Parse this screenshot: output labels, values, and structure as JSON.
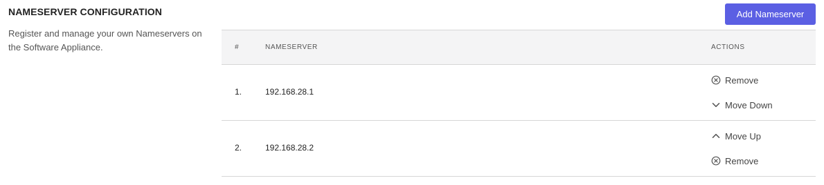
{
  "section": {
    "title": "NAMESERVER CONFIGURATION",
    "description": "Register and manage your own Nameservers on the Software Appliance."
  },
  "toolbar": {
    "add_label": "Add Nameserver"
  },
  "table": {
    "headers": {
      "num": "#",
      "nameserver": "NAMESERVER",
      "actions": "ACTIONS"
    },
    "rows": [
      {
        "num": "1.",
        "nameserver": "192.168.28.1",
        "actions": [
          {
            "label": "Remove",
            "icon": "remove-icon"
          },
          {
            "label": "Move Down",
            "icon": "chevron-down-icon"
          }
        ]
      },
      {
        "num": "2.",
        "nameserver": "192.168.28.2",
        "actions": [
          {
            "label": "Move Up",
            "icon": "chevron-up-icon"
          },
          {
            "label": "Remove",
            "icon": "remove-icon"
          }
        ]
      }
    ]
  },
  "colors": {
    "accent": "#5b5fe3",
    "header_bg": "#f4f4f5",
    "border": "#d6d6d6"
  }
}
